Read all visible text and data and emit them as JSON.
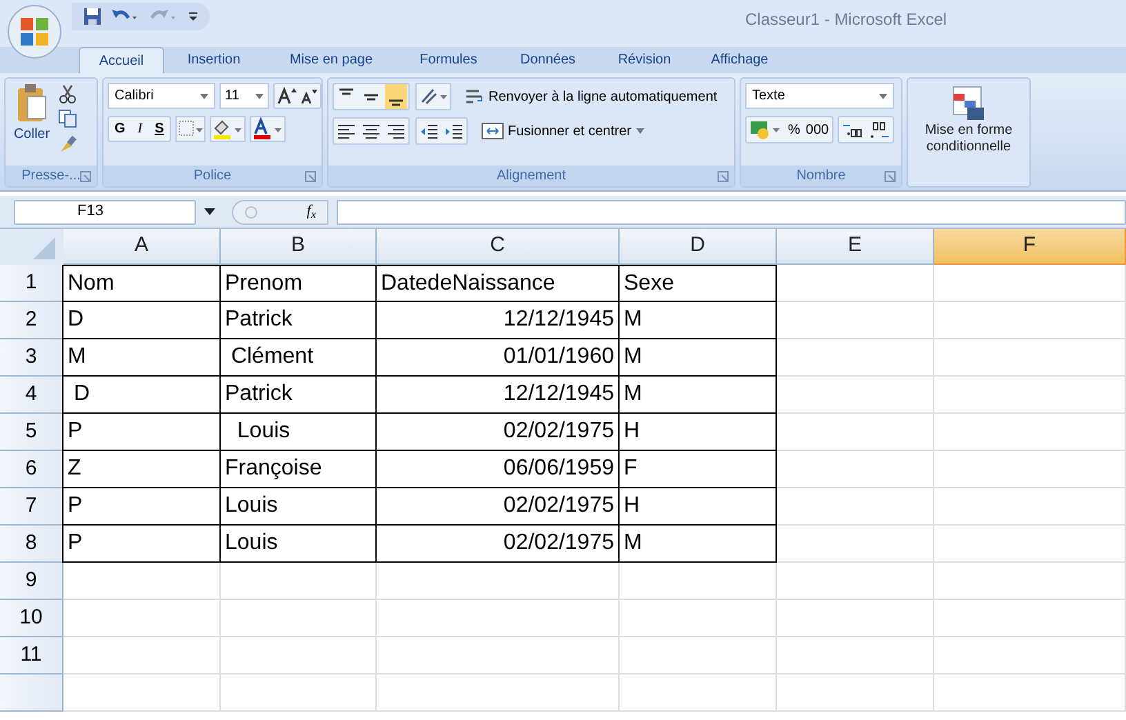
{
  "title": "Classeur1 - Microsoft Excel",
  "tabs": [
    {
      "label": "Accueil",
      "selected": true
    },
    {
      "label": "Insertion",
      "selected": false
    },
    {
      "label": "Mise en page",
      "selected": false
    },
    {
      "label": "Formules",
      "selected": false
    },
    {
      "label": "Données",
      "selected": false
    },
    {
      "label": "Révision",
      "selected": false
    },
    {
      "label": "Affichage",
      "selected": false
    }
  ],
  "clipboard": {
    "paste_label": "Coller",
    "group_label": "Presse-..."
  },
  "font": {
    "name": "Calibri",
    "size": "11",
    "bold": "G",
    "italic": "I",
    "underline": "S",
    "group_label": "Police"
  },
  "alignment": {
    "vertical": [
      {
        "selected": false
      },
      {
        "selected": false
      },
      {
        "selected": true
      }
    ],
    "wrap_label": "Renvoyer à la ligne automatiquement",
    "merge_label": "Fusionner et centrer",
    "group_label": "Alignement"
  },
  "number": {
    "format": "Texte",
    "percent": "%",
    "thousands": "000",
    "group_label": "Nombre"
  },
  "styles": {
    "conditional_label": "Mise en forme conditionnelle"
  },
  "formula_bar": {
    "name_box": "F13",
    "fx": "f$_{x}$"
  },
  "sheet": {
    "columns": [
      {
        "label": "A",
        "selected": false
      },
      {
        "label": "B",
        "selected": false
      },
      {
        "label": "C",
        "selected": false
      },
      {
        "label": "D",
        "selected": false
      },
      {
        "label": "E",
        "selected": false
      },
      {
        "label": "F",
        "selected": true
      }
    ],
    "rows": [
      {
        "number": "1",
        "cells": [
          {
            "text": "Nom",
            "kind": "text"
          },
          {
            "text": "Prenom",
            "kind": "text"
          },
          {
            "text": "DatedeNaissance",
            "kind": "text"
          },
          {
            "text": "Sexe",
            "kind": "text"
          }
        ]
      },
      {
        "number": "2",
        "cells": [
          {
            "text": "D",
            "kind": "text"
          },
          {
            "text": "Patrick",
            "kind": "text"
          },
          {
            "text": "12/12/1945",
            "kind": "date"
          },
          {
            "text": "M",
            "kind": "text"
          }
        ]
      },
      {
        "number": "3",
        "cells": [
          {
            "text": "M",
            "kind": "text"
          },
          {
            "text": " Clément",
            "kind": "text"
          },
          {
            "text": "01/01/1960",
            "kind": "date"
          },
          {
            "text": "M",
            "kind": "text"
          }
        ]
      },
      {
        "number": "4",
        "cells": [
          {
            "text": " D",
            "kind": "text"
          },
          {
            "text": "Patrick",
            "kind": "text"
          },
          {
            "text": "12/12/1945",
            "kind": "date"
          },
          {
            "text": "M",
            "kind": "text"
          }
        ]
      },
      {
        "number": "5",
        "cells": [
          {
            "text": "P",
            "kind": "text"
          },
          {
            "text": "  Louis",
            "kind": "text"
          },
          {
            "text": "02/02/1975",
            "kind": "date"
          },
          {
            "text": "H",
            "kind": "text"
          }
        ]
      },
      {
        "number": "6",
        "cells": [
          {
            "text": "Z",
            "kind": "text"
          },
          {
            "text": "Françoise",
            "kind": "text"
          },
          {
            "text": "06/06/1959",
            "kind": "date"
          },
          {
            "text": "F",
            "kind": "text"
          }
        ]
      },
      {
        "number": "7",
        "cells": [
          {
            "text": "P",
            "kind": "text"
          },
          {
            "text": "Louis",
            "kind": "text"
          },
          {
            "text": "02/02/1975",
            "kind": "date"
          },
          {
            "text": "H",
            "kind": "text"
          }
        ]
      },
      {
        "number": "8",
        "cells": [
          {
            "text": "P",
            "kind": "text"
          },
          {
            "text": "Louis",
            "kind": "text"
          },
          {
            "text": "02/02/1975",
            "kind": "date"
          },
          {
            "text": "M",
            "kind": "text"
          }
        ]
      },
      {
        "number": "9",
        "cells": []
      },
      {
        "number": "10",
        "cells": []
      },
      {
        "number": "11",
        "cells": []
      }
    ]
  }
}
